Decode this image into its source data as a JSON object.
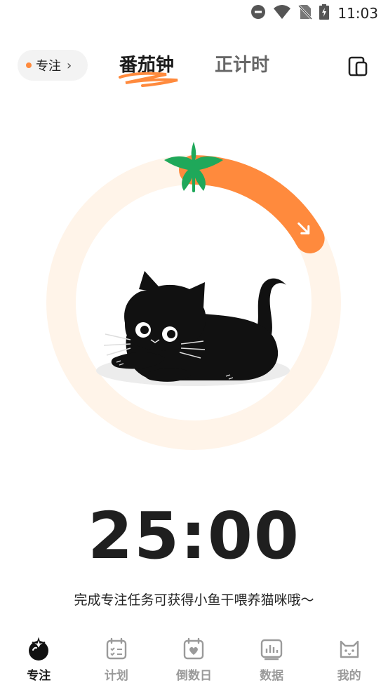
{
  "status": {
    "time": "11:03"
  },
  "header": {
    "mode_chip": {
      "label": "专注"
    },
    "tabs": [
      {
        "label": "番茄钟",
        "active": true
      },
      {
        "label": "正计时",
        "active": false
      }
    ]
  },
  "timer": {
    "display": "25:00",
    "progress_fraction": 0.17,
    "hint": "完成专注任务可获得小鱼干喂养猫咪哦～"
  },
  "colors": {
    "accent": "#ff8a3d",
    "ring_track": "#fff4e9",
    "leaf": "#1fa85a"
  },
  "bottom_nav": {
    "items": [
      {
        "label": "专注",
        "icon": "tomato-icon",
        "active": true
      },
      {
        "label": "计划",
        "icon": "calendar-checklist-icon",
        "active": false
      },
      {
        "label": "倒数日",
        "icon": "calendar-heart-icon",
        "active": false
      },
      {
        "label": "数据",
        "icon": "bar-chart-icon",
        "active": false
      },
      {
        "label": "我的",
        "icon": "cat-face-icon",
        "active": false
      }
    ]
  }
}
